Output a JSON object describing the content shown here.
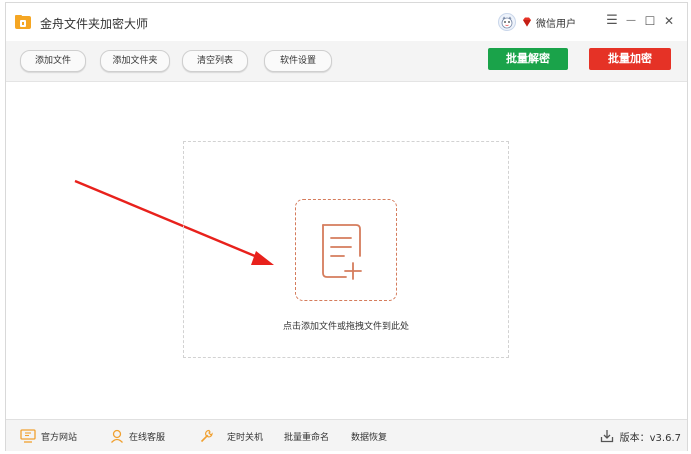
{
  "app": {
    "title": "金舟文件夹加密大师"
  },
  "user": {
    "name": "微信用户"
  },
  "window_controls": {
    "menu": "☰",
    "minimize": "—",
    "maximize": "☐",
    "close": "✕"
  },
  "toolbar": {
    "add_file": "添加文件",
    "add_folder": "添加文件夹",
    "clear_list": "清空列表",
    "settings": "软件设置",
    "batch_decrypt": "批量解密",
    "batch_encrypt": "批量加密"
  },
  "dropzone": {
    "hint": "点击添加文件或拖拽文件到此处"
  },
  "statusbar": {
    "website": "官方网站",
    "support": "在线客服",
    "timer_shutdown": "定时关机",
    "batch_rename": "批量重命名",
    "data_recovery": "数据恢复",
    "version": "版本：v3.6.7"
  },
  "colors": {
    "decrypt_green": "#1aa34a",
    "encrypt_red": "#e53226",
    "accent_orange": "#d57c5c",
    "arrow_red": "#e8211c"
  }
}
